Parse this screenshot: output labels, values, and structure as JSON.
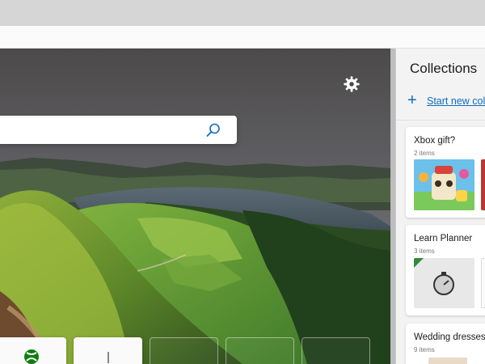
{
  "search": {
    "value": "",
    "placeholder": ""
  },
  "icons": {
    "settings": "gear-icon",
    "search": "search-icon",
    "xbox": "xbox-icon",
    "add": "plus-icon"
  },
  "colors": {
    "accent": "#0f6cbd",
    "pane_background": "#f3f3f3"
  },
  "collections": {
    "title": "Collections",
    "start_new_label": "Start new colle",
    "start_new_icon": "+",
    "items": [
      {
        "title": "Xbox gift?",
        "count": "2 items"
      },
      {
        "title": "Learn Planner",
        "count": "3 items"
      },
      {
        "title": "Wedding dresses",
        "count": "9 items"
      }
    ]
  }
}
